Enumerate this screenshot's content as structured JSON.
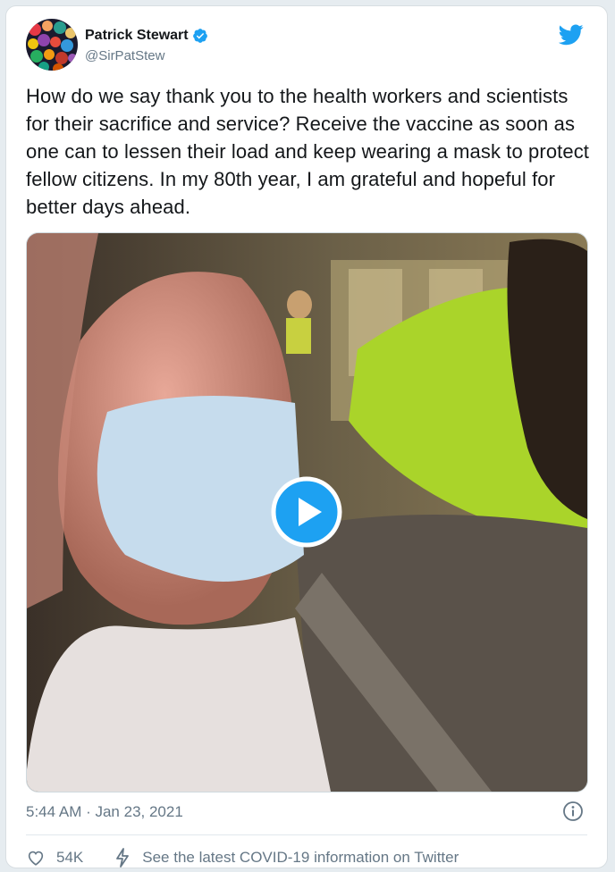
{
  "author": {
    "name": "Patrick Stewart",
    "handle": "@SirPatStew",
    "verified": true,
    "avatar_icon": "colorful-balls-avatar"
  },
  "tweet": {
    "text": "How do we say thank you to the health workers and scientists for their sacrifice and service? Receive the vaccine as soon as one can to lessen their load and keep wearing a mask to protect fellow citizens. In my 80th year, I am grateful and hopeful for better days ahead.",
    "timestamp": "5:44 AM · Jan 23, 2021"
  },
  "media": {
    "type": "video",
    "play_icon": "play-icon"
  },
  "footer": {
    "likes": "54K",
    "covid_link": "See the latest COVID-19 information on Twitter"
  },
  "colors": {
    "twitter_blue": "#1da1f2",
    "text": "#14171a",
    "secondary": "#657786"
  }
}
